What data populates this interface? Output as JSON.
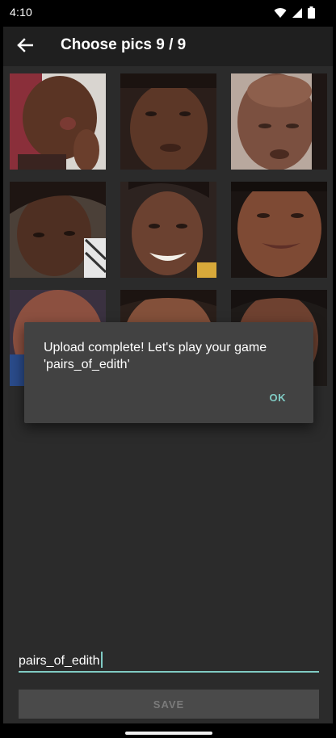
{
  "status_bar": {
    "time": "4:10",
    "icons": [
      "wifi-icon",
      "signal-icon",
      "battery-icon"
    ]
  },
  "app_bar": {
    "back_icon": "arrow-back-icon",
    "title": "Choose pics 9 / 9"
  },
  "photos": {
    "count": 9,
    "items": [
      "photo-1",
      "photo-2",
      "photo-3",
      "photo-4",
      "photo-5",
      "photo-6",
      "photo-7",
      "photo-8",
      "photo-9"
    ]
  },
  "dialog": {
    "message": "Upload complete! Let's play your game 'pairs_of_edith'",
    "ok_label": "OK"
  },
  "form": {
    "game_name_value": "pairs_of_edith",
    "save_label": "SAVE"
  },
  "colors": {
    "accent": "#80cbc4",
    "background": "#2b2b2b",
    "app_bar": "#1f1f1f",
    "dialog": "#424242"
  }
}
